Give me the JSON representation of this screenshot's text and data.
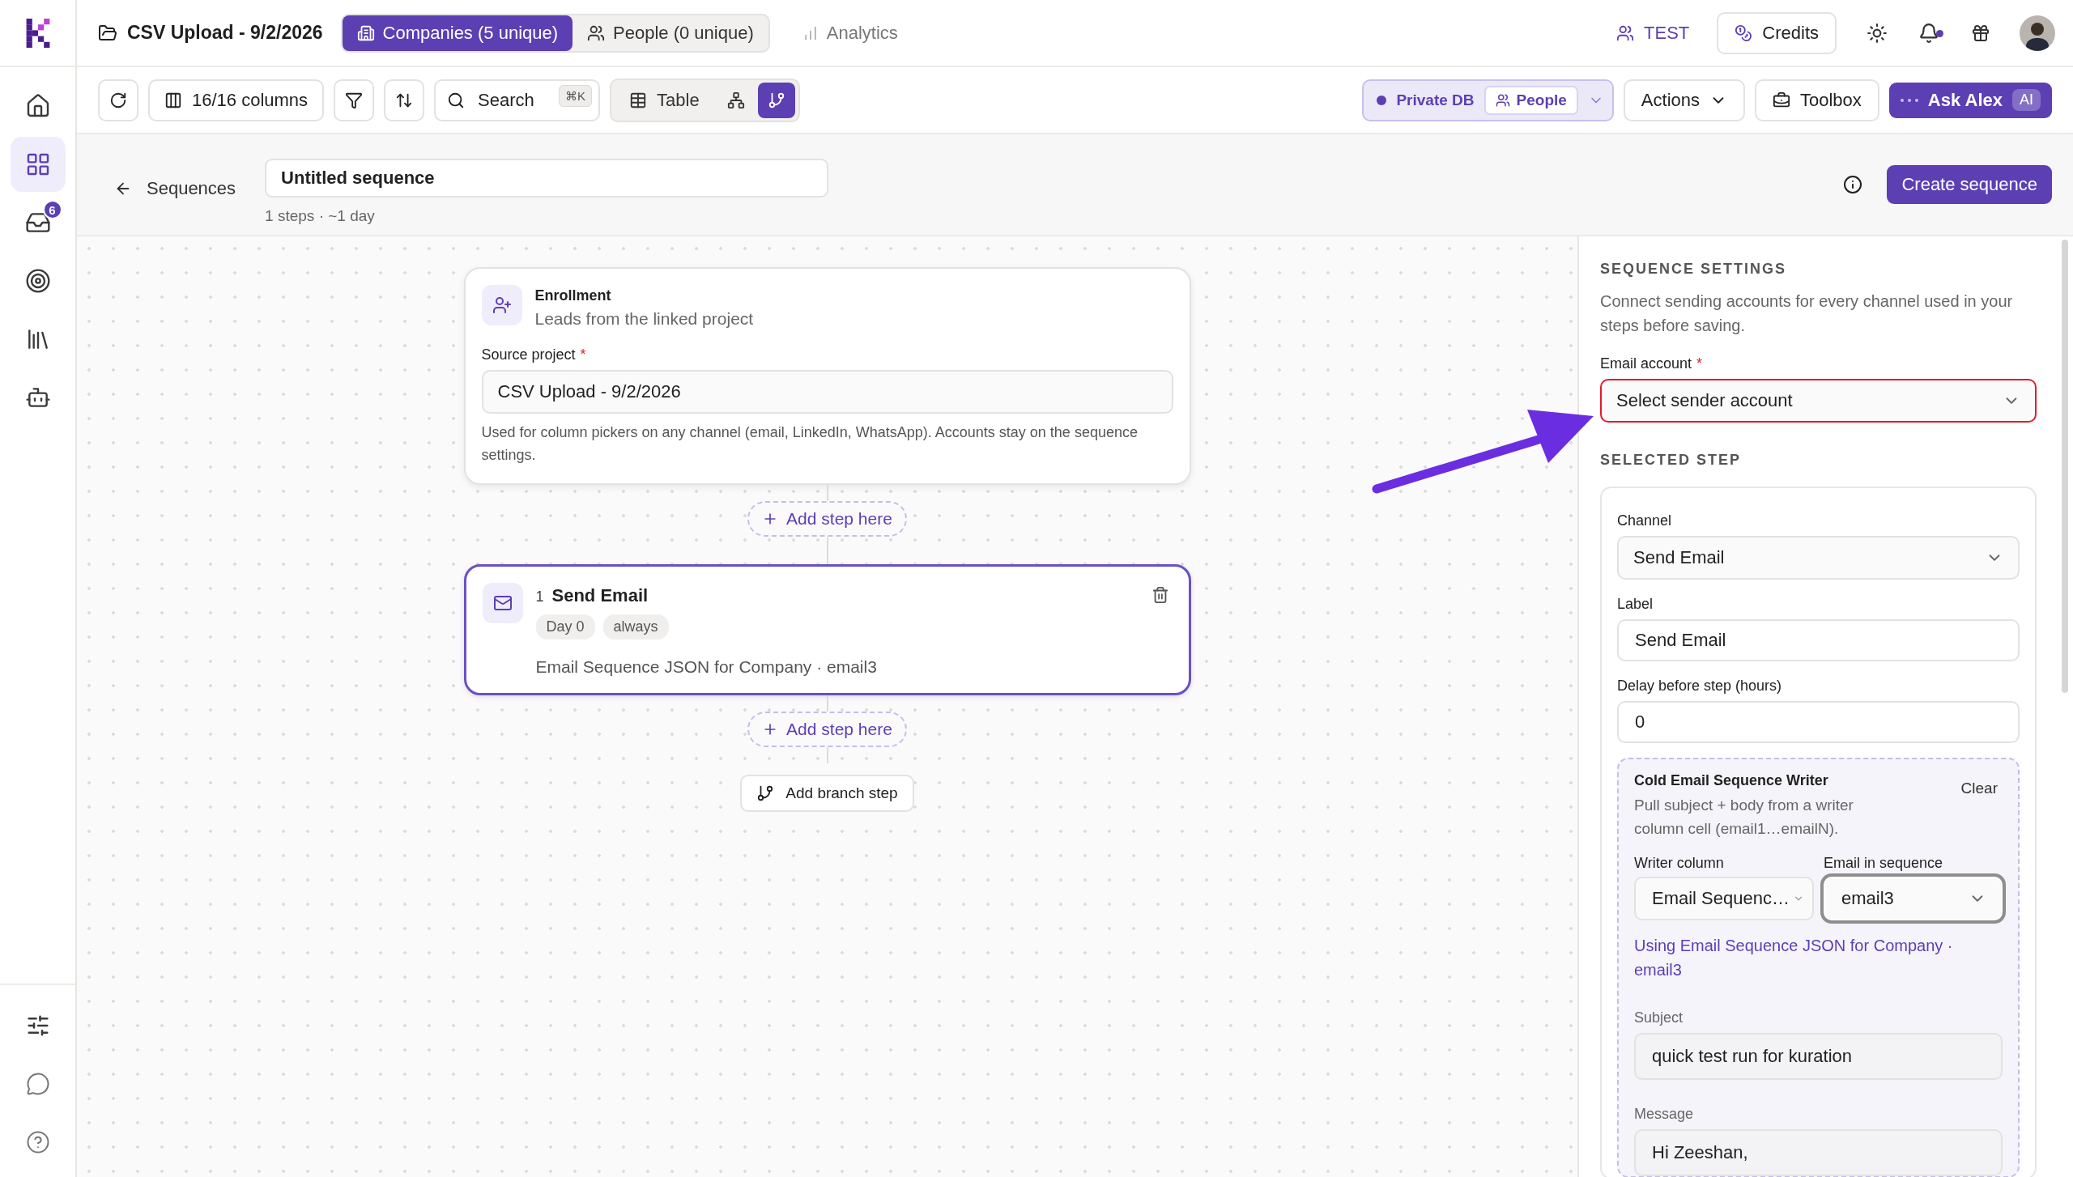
{
  "sidebar": {
    "items": [
      {
        "selected": false
      },
      {
        "selected": true
      },
      {
        "selected": false,
        "badge": "6"
      },
      {
        "selected": false
      },
      {
        "selected": false
      },
      {
        "selected": false
      }
    ]
  },
  "header": {
    "project": "CSV Upload - 9/2/2026",
    "tabs": [
      {
        "label": "Companies (5 unique)",
        "kind": "segment",
        "selected": true
      },
      {
        "label": "People (0 unique)",
        "kind": "segment",
        "selected": false
      },
      {
        "label": "Analytics",
        "kind": "link",
        "selected": false
      }
    ],
    "workspace": "TEST",
    "credits": "Credits",
    "notifications_unread": true
  },
  "toolbar": {
    "columns": "16/16 columns",
    "search": {
      "placeholder": "Search",
      "shortcut": "⌘K"
    },
    "views": [
      {
        "label": "Table",
        "selected": false
      },
      {
        "selected": false
      },
      {
        "selected": true
      }
    ],
    "database": {
      "label": "Private DB",
      "entity": "People"
    },
    "actions": "Actions",
    "toolbox": "Toolbox",
    "assistant": {
      "label": "Ask Alex",
      "badge": "AI"
    }
  },
  "sequence": {
    "back": "Sequences",
    "name": "Untitled sequence",
    "meta": "1 steps · ~1 day",
    "create": "Create sequence"
  },
  "canvas": {
    "enrollment": {
      "title": "Enrollment",
      "subtitle": "Leads from the linked project",
      "field_label": "Source project",
      "required_mark": "*",
      "value": "CSV Upload - 9/2/2026",
      "help": "Used for column pickers on any channel (email, LinkedIn, WhatsApp). Accounts stay on the sequence settings."
    },
    "flow": [
      {
        "kind": "add",
        "label": "Add step here"
      },
      {
        "kind": "step",
        "number": "1",
        "title": "Send Email",
        "tags": [
          "Day 0",
          "always"
        ],
        "detail": "Email Sequence JSON for Company · email3",
        "selected": true
      },
      {
        "kind": "add",
        "label": "Add step here"
      },
      {
        "kind": "branch",
        "label": "Add branch step"
      }
    ]
  },
  "settings": {
    "heading": "SEQUENCE SETTINGS",
    "description": "Connect sending accounts for every channel used in your steps before saving.",
    "email_account": {
      "label": "Email account",
      "required_mark": "*",
      "value": "Select sender account",
      "invalid": true
    }
  },
  "selected_step": {
    "heading": "SELECTED STEP",
    "channel": {
      "label": "Channel",
      "value": "Send Email"
    },
    "step_label": {
      "label": "Label",
      "value": "Send Email"
    },
    "delay": {
      "label": "Delay before step (hours)",
      "value": "0"
    },
    "writer": {
      "title": "Cold Email Sequence Writer",
      "description": "Pull subject + body from a writer column cell (email1…emailN).",
      "clear": "Clear",
      "column": {
        "label": "Writer column",
        "value": "Email Sequenc…"
      },
      "email": {
        "label": "Email in sequence",
        "value": "email3",
        "focused": true
      },
      "note": "Using Email Sequence JSON for Company · email3",
      "subject": {
        "label": "Subject",
        "value": "quick test run for kuration"
      },
      "message": {
        "label": "Message",
        "value": "Hi Zeeshan,"
      }
    }
  }
}
